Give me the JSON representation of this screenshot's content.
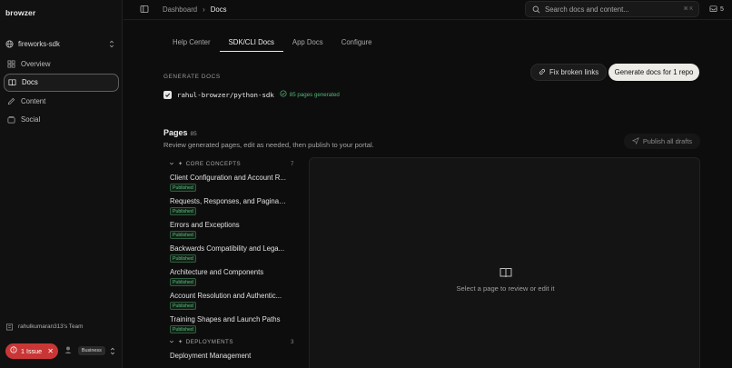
{
  "sidebar": {
    "brand": "browzer",
    "project": "fireworks-sdk",
    "items": [
      {
        "label": "Overview",
        "icon": "grid-icon"
      },
      {
        "label": "Docs",
        "icon": "book-icon",
        "active": true
      },
      {
        "label": "Content",
        "icon": "pencil-icon"
      },
      {
        "label": "Social",
        "icon": "stack-icon"
      }
    ],
    "team": "rahulkumaran313's Team",
    "issue_label": "1 Issue",
    "plan": "Business"
  },
  "topbar": {
    "crumb_root": "Dashboard",
    "crumb_separator": "›",
    "crumb_current": "Docs",
    "search_placeholder": "Search docs and content...",
    "search_shortcut": "⌘ K",
    "notifications": "5"
  },
  "tabs": [
    "Help Center",
    "SDK/CLI Docs",
    "App Docs",
    "Configure"
  ],
  "active_tab": 1,
  "generate": {
    "section_label": "GENERATE DOCS",
    "repo": "rahul-browzer/python-sdk",
    "status": "85 pages generated",
    "fix_label": "Fix broken links",
    "generate_label": "Generate docs for 1 repo"
  },
  "pages": {
    "title": "Pages",
    "count": "85",
    "description": "Review generated pages, edit as needed, then publish to your portal.",
    "publish_label": "Publish all drafts",
    "groups": [
      {
        "name": "CORE CONCEPTS",
        "count": "7",
        "items": [
          {
            "title": "Client Configuration and Account R...",
            "status": "Published"
          },
          {
            "title": "Requests, Responses, and Paginati...",
            "status": "Published"
          },
          {
            "title": "Errors and Exceptions",
            "status": "Published"
          },
          {
            "title": "Backwards Compatibility and Lega...",
            "status": "Published"
          },
          {
            "title": "Architecture and Components",
            "status": "Published"
          },
          {
            "title": "Account Resolution and Authentic...",
            "status": "Published"
          },
          {
            "title": "Training Shapes and Launch Paths",
            "status": "Published"
          }
        ]
      },
      {
        "name": "DEPLOYMENTS",
        "count": "3",
        "items": [
          {
            "title": "Deployment Management",
            "status": ""
          }
        ]
      }
    ]
  },
  "preview": {
    "message": "Select a page to review or edit it"
  },
  "colors": {
    "background": "#0d0d0d",
    "accent_green": "#52b876",
    "issue_red": "#c93636",
    "primary_button": "#ecebe6"
  }
}
